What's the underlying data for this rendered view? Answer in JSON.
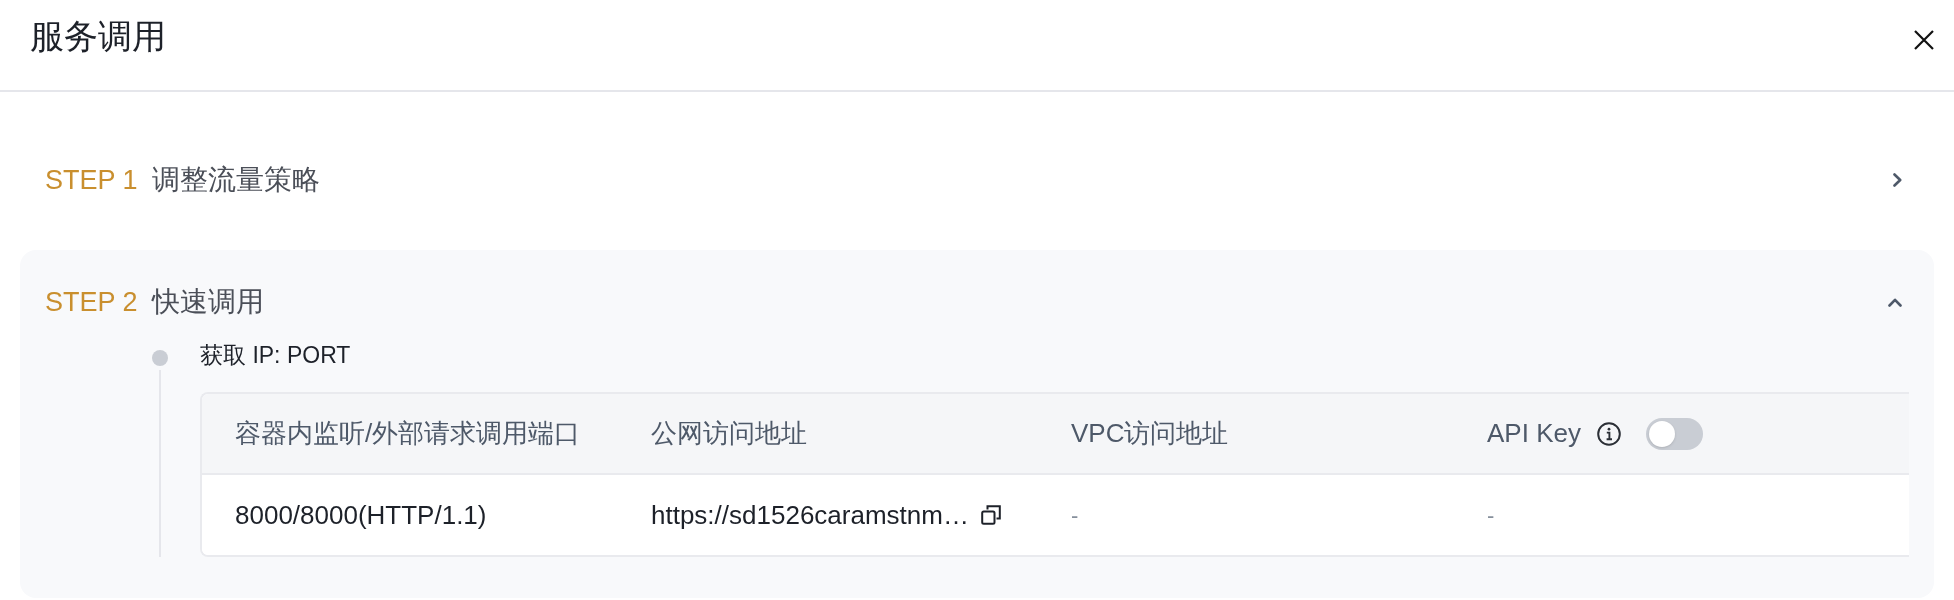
{
  "dialog": {
    "title": "服务调用"
  },
  "steps": [
    {
      "label": "STEP 1",
      "title": "调整流量策略",
      "expanded": false
    },
    {
      "label": "STEP 2",
      "title": "快速调用",
      "expanded": true,
      "sections": [
        {
          "title": "获取 IP: PORT",
          "table": {
            "columns": [
              {
                "kind": "text",
                "label": "容器内监听/外部请求调用端口"
              },
              {
                "kind": "text",
                "label": "公网访问地址"
              },
              {
                "kind": "text",
                "label": "VPC访问地址"
              },
              {
                "kind": "switch",
                "label": "API Key",
                "on": false
              }
            ],
            "rows": [
              {
                "cells": [
                  {
                    "kind": "text",
                    "text": "8000/8000(HTTP/1.1)"
                  },
                  {
                    "kind": "copyable",
                    "text": "https://sd1526caramstnm…"
                  },
                  {
                    "kind": "empty",
                    "text": "-"
                  },
                  {
                    "kind": "empty",
                    "text": "-"
                  }
                ]
              }
            ]
          }
        }
      ]
    }
  ]
}
